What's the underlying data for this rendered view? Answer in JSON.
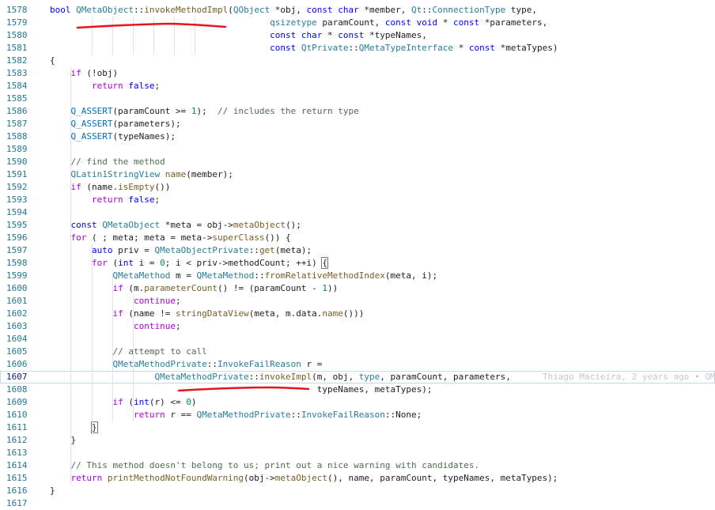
{
  "editor": {
    "current_line": 1607,
    "blame": "Thiago Macieira, 2 years ago • QM",
    "lines": [
      {
        "n": "1578",
        "tokens": [
          [
            "kw",
            "bool "
          ],
          [
            "ty",
            "QMetaObject"
          ],
          [
            "df",
            "::"
          ],
          [
            "fn",
            "invokeMethodImpl"
          ],
          [
            "df",
            "("
          ],
          [
            "ty",
            "QObject"
          ],
          [
            "df",
            " *obj, "
          ],
          [
            "kw",
            "const char"
          ],
          [
            "df",
            " *member, "
          ],
          [
            "ty",
            "Qt"
          ],
          [
            "df",
            "::"
          ],
          [
            "ty",
            "ConnectionType"
          ],
          [
            "df",
            " type,"
          ]
        ]
      },
      {
        "n": "1579",
        "tokens": [
          [
            "df",
            "                                          "
          ],
          [
            "ty",
            "qsizetype"
          ],
          [
            "df",
            " paramCount, "
          ],
          [
            "kw",
            "const void"
          ],
          [
            "df",
            " * "
          ],
          [
            "kw",
            "const"
          ],
          [
            "df",
            " *parameters,"
          ]
        ]
      },
      {
        "n": "1580",
        "tokens": [
          [
            "df",
            "                                          "
          ],
          [
            "kw",
            "const char"
          ],
          [
            "df",
            " * "
          ],
          [
            "kw",
            "const"
          ],
          [
            "df",
            " *typeNames,"
          ]
        ]
      },
      {
        "n": "1581",
        "tokens": [
          [
            "df",
            "                                          "
          ],
          [
            "kw",
            "const "
          ],
          [
            "ty",
            "QtPrivate"
          ],
          [
            "df",
            "::"
          ],
          [
            "ty",
            "QMetaTypeInterface"
          ],
          [
            "df",
            " * "
          ],
          [
            "kw",
            "const"
          ],
          [
            "df",
            " *metaTypes)"
          ]
        ]
      },
      {
        "n": "1582",
        "tokens": [
          [
            "df",
            "{"
          ]
        ]
      },
      {
        "n": "1583",
        "tokens": [
          [
            "df",
            "    "
          ],
          [
            "fnm",
            "if"
          ],
          [
            "df",
            " (!obj)"
          ]
        ]
      },
      {
        "n": "1584",
        "tokens": [
          [
            "df",
            "        "
          ],
          [
            "fnm",
            "return "
          ],
          [
            "kw",
            "false"
          ],
          [
            "df",
            ";"
          ]
        ]
      },
      {
        "n": "1585",
        "tokens": []
      },
      {
        "n": "1586",
        "tokens": [
          [
            "df",
            "    "
          ],
          [
            "mac",
            "Q_ASSERT"
          ],
          [
            "df",
            "(paramCount >= "
          ],
          [
            "nm",
            "1"
          ],
          [
            "df",
            ");  "
          ],
          [
            "cm",
            "// includes the return type"
          ]
        ]
      },
      {
        "n": "1587",
        "tokens": [
          [
            "df",
            "    "
          ],
          [
            "mac",
            "Q_ASSERT"
          ],
          [
            "df",
            "(parameters);"
          ]
        ]
      },
      {
        "n": "1588",
        "tokens": [
          [
            "df",
            "    "
          ],
          [
            "mac",
            "Q_ASSERT"
          ],
          [
            "df",
            "(typeNames);"
          ]
        ]
      },
      {
        "n": "1589",
        "tokens": []
      },
      {
        "n": "1590",
        "tokens": [
          [
            "df",
            "    "
          ],
          [
            "cm",
            "// find the method"
          ]
        ]
      },
      {
        "n": "1591",
        "tokens": [
          [
            "df",
            "    "
          ],
          [
            "ty",
            "QLatin1StringView"
          ],
          [
            "df",
            " "
          ],
          [
            "fn",
            "name"
          ],
          [
            "df",
            "(member);"
          ]
        ]
      },
      {
        "n": "1592",
        "tokens": [
          [
            "df",
            "    "
          ],
          [
            "fnm",
            "if"
          ],
          [
            "df",
            " (name."
          ],
          [
            "fn",
            "isEmpty"
          ],
          [
            "df",
            "())"
          ]
        ]
      },
      {
        "n": "1593",
        "tokens": [
          [
            "df",
            "        "
          ],
          [
            "fnm",
            "return "
          ],
          [
            "kw",
            "false"
          ],
          [
            "df",
            ";"
          ]
        ]
      },
      {
        "n": "1594",
        "tokens": []
      },
      {
        "n": "1595",
        "tokens": [
          [
            "df",
            "    "
          ],
          [
            "kw",
            "const "
          ],
          [
            "ty",
            "QMetaObject"
          ],
          [
            "df",
            " *meta = obj->"
          ],
          [
            "fn",
            "metaObject"
          ],
          [
            "df",
            "();"
          ]
        ]
      },
      {
        "n": "1596",
        "tokens": [
          [
            "df",
            "    "
          ],
          [
            "fnm",
            "for"
          ],
          [
            "df",
            " ( ; meta; meta = meta->"
          ],
          [
            "fn",
            "superClass"
          ],
          [
            "df",
            "()) {"
          ]
        ]
      },
      {
        "n": "1597",
        "tokens": [
          [
            "df",
            "        "
          ],
          [
            "kw",
            "auto"
          ],
          [
            "df",
            " priv = "
          ],
          [
            "ty",
            "QMetaObjectPrivate"
          ],
          [
            "df",
            "::"
          ],
          [
            "fn",
            "get"
          ],
          [
            "df",
            "(meta);"
          ]
        ]
      },
      {
        "n": "1598",
        "tokens": [
          [
            "df",
            "        "
          ],
          [
            "fnm",
            "for"
          ],
          [
            "df",
            " ("
          ],
          [
            "kw",
            "int"
          ],
          [
            "df",
            " i = "
          ],
          [
            "nm",
            "0"
          ],
          [
            "df",
            "; i < priv->methodCount; ++i) "
          ],
          [
            "box",
            "{"
          ]
        ]
      },
      {
        "n": "1599",
        "tokens": [
          [
            "df",
            "            "
          ],
          [
            "ty",
            "QMetaMethod"
          ],
          [
            "df",
            " m = "
          ],
          [
            "ty",
            "QMetaMethod"
          ],
          [
            "df",
            "::"
          ],
          [
            "fn",
            "fromRelativeMethodIndex"
          ],
          [
            "df",
            "(meta, i);"
          ]
        ]
      },
      {
        "n": "1600",
        "tokens": [
          [
            "df",
            "            "
          ],
          [
            "fnm",
            "if"
          ],
          [
            "df",
            " (m."
          ],
          [
            "fn",
            "parameterCount"
          ],
          [
            "df",
            "() != (paramCount - "
          ],
          [
            "nm",
            "1"
          ],
          [
            "df",
            "))"
          ]
        ]
      },
      {
        "n": "1601",
        "tokens": [
          [
            "df",
            "                "
          ],
          [
            "fnm",
            "continue"
          ],
          [
            "df",
            ";"
          ]
        ]
      },
      {
        "n": "1602",
        "tokens": [
          [
            "df",
            "            "
          ],
          [
            "fnm",
            "if"
          ],
          [
            "df",
            " (name != "
          ],
          [
            "fn",
            "stringDataView"
          ],
          [
            "df",
            "(meta, m.data."
          ],
          [
            "fn",
            "name"
          ],
          [
            "df",
            "()))"
          ]
        ]
      },
      {
        "n": "1603",
        "tokens": [
          [
            "df",
            "                "
          ],
          [
            "fnm",
            "continue"
          ],
          [
            "df",
            ";"
          ]
        ]
      },
      {
        "n": "1604",
        "tokens": []
      },
      {
        "n": "1605",
        "tokens": [
          [
            "df",
            "            "
          ],
          [
            "cm",
            "// attempt to call"
          ]
        ]
      },
      {
        "n": "1606",
        "tokens": [
          [
            "df",
            "            "
          ],
          [
            "ty",
            "QMetaMethodPrivate"
          ],
          [
            "df",
            "::"
          ],
          [
            "ty",
            "InvokeFailReason"
          ],
          [
            "df",
            " r ="
          ]
        ]
      },
      {
        "n": "1607",
        "tokens": [
          [
            "df",
            "                    "
          ],
          [
            "ty",
            "QMetaMethodPrivate"
          ],
          [
            "df",
            "::"
          ],
          [
            "fn",
            "invokeImpl"
          ],
          [
            "df",
            "(m, obj, "
          ],
          [
            "ty",
            "type"
          ],
          [
            "df",
            ", paramCount, parameters,"
          ]
        ]
      },
      {
        "n": "1608",
        "tokens": [
          [
            "df",
            "                                                   typeNames, metaTypes);"
          ]
        ]
      },
      {
        "n": "1609",
        "tokens": [
          [
            "df",
            "            "
          ],
          [
            "fnm",
            "if"
          ],
          [
            "df",
            " ("
          ],
          [
            "kw",
            "int"
          ],
          [
            "df",
            "(r) <= "
          ],
          [
            "nm",
            "0"
          ],
          [
            "df",
            ")"
          ]
        ]
      },
      {
        "n": "1610",
        "tokens": [
          [
            "df",
            "                "
          ],
          [
            "fnm",
            "return"
          ],
          [
            "df",
            " r == "
          ],
          [
            "ty",
            "QMetaMethodPrivate"
          ],
          [
            "df",
            "::"
          ],
          [
            "ty",
            "InvokeFailReason"
          ],
          [
            "df",
            "::None;"
          ]
        ]
      },
      {
        "n": "1611",
        "tokens": [
          [
            "df",
            "        "
          ],
          [
            "box",
            "}"
          ]
        ]
      },
      {
        "n": "1612",
        "tokens": [
          [
            "df",
            "    }"
          ]
        ]
      },
      {
        "n": "1613",
        "tokens": []
      },
      {
        "n": "1614",
        "tokens": [
          [
            "df",
            "    "
          ],
          [
            "cm",
            "// This method doesn't belong to us; print out a nice warning with candidates."
          ]
        ]
      },
      {
        "n": "1615",
        "tokens": [
          [
            "df",
            "    "
          ],
          [
            "fnm",
            "return "
          ],
          [
            "fn",
            "printMethodNotFoundWarning"
          ],
          [
            "df",
            "(obj->"
          ],
          [
            "fn",
            "metaObject"
          ],
          [
            "df",
            "(), name, paramCount, typeNames, metaTypes);"
          ]
        ]
      },
      {
        "n": "1616",
        "tokens": [
          [
            "df",
            "}"
          ]
        ]
      },
      {
        "n": "1617",
        "tokens": []
      }
    ]
  },
  "annotations": {
    "underline_color": "#e8141c"
  }
}
